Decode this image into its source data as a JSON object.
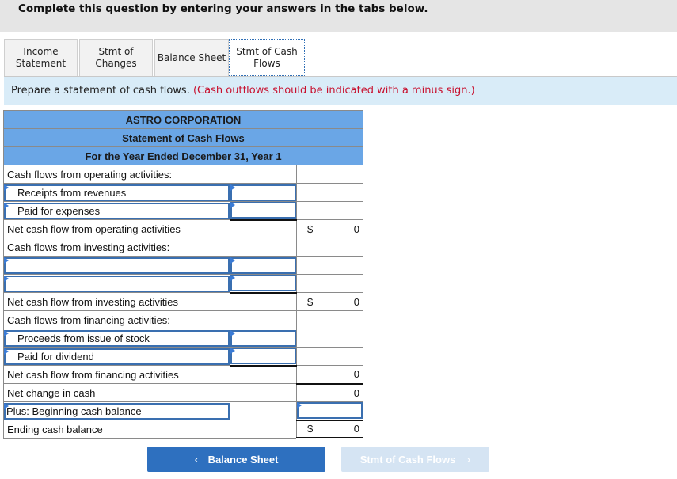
{
  "instruction": "Complete this question by entering your answers in the tabs below.",
  "tabs": [
    {
      "label_line1": "Income",
      "label_line2": "Statement",
      "active": false
    },
    {
      "label_line1": "Stmt of",
      "label_line2": "Changes",
      "active": false
    },
    {
      "label_line1": "Balance Sheet",
      "label_line2": "",
      "active": false
    },
    {
      "label_line1": "Stmt of Cash",
      "label_line2": "Flows",
      "active": true
    }
  ],
  "prompt": {
    "text": "Prepare a statement of cash flows.",
    "note": "(Cash outflows should be indicated with a minus sign.)"
  },
  "statement": {
    "company": "ASTRO CORPORATION",
    "title": "Statement of Cash Flows",
    "period": "For the Year Ended December 31, Year 1",
    "rows": {
      "op_header": "Cash flows from operating activities:",
      "receipts": "Receipts from revenues",
      "paid_expenses": "Paid for expenses",
      "net_op": "Net cash flow from operating activities",
      "net_op_currency": "$",
      "net_op_value": "0",
      "inv_header": "Cash flows from investing activities:",
      "inv_line1": "",
      "inv_line2": "",
      "net_inv": "Net cash flow from investing activities",
      "net_inv_currency": "$",
      "net_inv_value": "0",
      "fin_header": "Cash flows from financing activities:",
      "proceeds": "Proceeds from issue of stock",
      "paid_dividend": "Paid for dividend",
      "net_fin": "Net cash flow from financing activities",
      "net_fin_value": "0",
      "net_change": "Net change in cash",
      "net_change_value": "0",
      "beginning": "Plus: Beginning cash balance",
      "ending": "Ending cash balance",
      "ending_currency": "$",
      "ending_value": "0"
    }
  },
  "nav": {
    "prev_label": "Balance Sheet",
    "prev_icon": "‹",
    "next_label": "Stmt of Cash Flows",
    "next_icon": "›"
  }
}
